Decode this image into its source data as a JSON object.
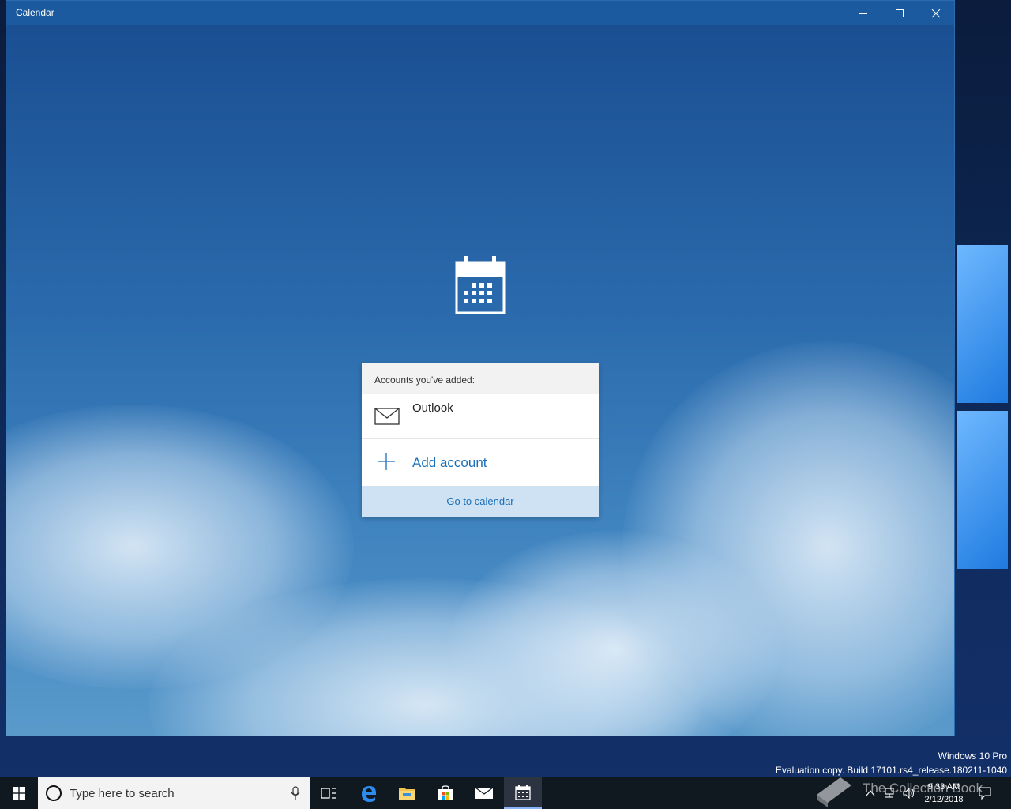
{
  "window": {
    "title": "Calendar"
  },
  "dialog": {
    "header": "Accounts you've added:",
    "accounts": [
      {
        "name": "Outlook",
        "icon": "mail-envelope-icon"
      }
    ],
    "add_account_label": "Add account",
    "goto_label": "Go to calendar"
  },
  "watermark": {
    "edition": "Windows 10 Pro",
    "build": "Evaluation copy. Build 17101.rs4_release.180211-1040"
  },
  "overlay": {
    "collection_text": "The Collection Book"
  },
  "taskbar": {
    "search_placeholder": "Type here to search",
    "time": "9:33 AM",
    "date": "2/12/2018"
  },
  "colors": {
    "accent": "#1a6fb8",
    "title_bar": "#1b5a9e",
    "taskbar": "#101820",
    "goto_bg": "#cfe2f3"
  }
}
